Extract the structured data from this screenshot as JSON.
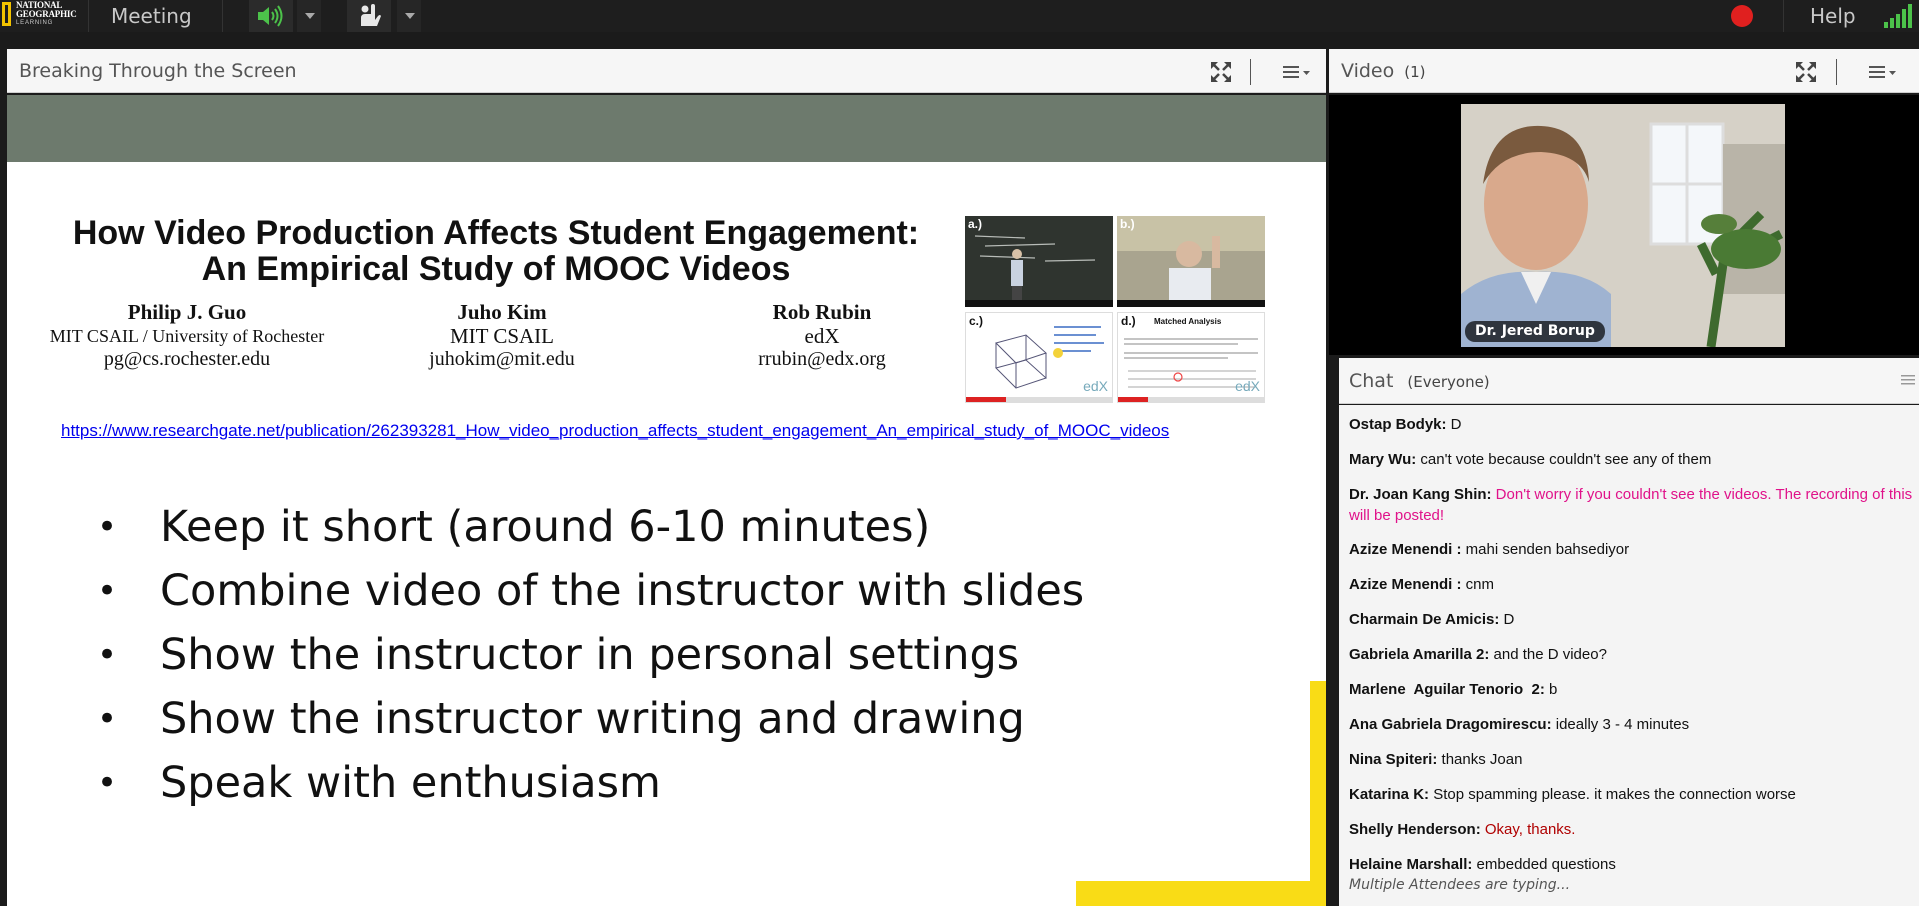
{
  "menubar": {
    "logo_line1": "NATIONAL",
    "logo_line2": "GEOGRAPHIC",
    "logo_line3": "LEARNING",
    "meeting_label": "Meeting",
    "help_label": "Help"
  },
  "share_pod": {
    "title": "Breaking Through the Screen"
  },
  "slide": {
    "paper_title_line1": "How Video Production Affects Student Engagement:",
    "paper_title_line2": "An Empirical Study of MOOC Videos",
    "authors": [
      {
        "name": "Philip J. Guo",
        "affiliation": "MIT CSAIL / University of Rochester",
        "email": "pg@cs.rochester.edu"
      },
      {
        "name": "Juho Kim",
        "affiliation": "MIT CSAIL",
        "email": "juhokim@mit.edu"
      },
      {
        "name": "Rob Rubin",
        "affiliation": "edX",
        "email": "rrubin@edx.org"
      }
    ],
    "thumb_labels": [
      "a.)",
      "b.)",
      "c.)",
      "d.)"
    ],
    "thumb_d_caption": "Matched Analysis",
    "thumb_brand": "edX",
    "link": "https://www.researchgate.net/publication/262393281_How_video_production_affects_student_engagement_An_empirical_study_of_MOOC_videos",
    "bullets": [
      "Keep it short (around 6-10 minutes)",
      "Combine video of the instructor with slides",
      "Show the instructor in personal settings",
      "Show the instructor writing and drawing",
      "Speak with enthusiasm"
    ]
  },
  "video_pod": {
    "title": "Video",
    "count": "(1)",
    "presenter_name": "Dr. Jered Borup"
  },
  "chat_pod": {
    "title": "Chat",
    "audience": "(Everyone)",
    "messages": [
      {
        "sender": "Ostap Bodyk:",
        "text": " D",
        "color": "#111111"
      },
      {
        "sender": "Mary Wu:",
        "text": " can't vote because couldn't see any of them",
        "color": "#111111"
      },
      {
        "sender": "Dr. Joan Kang Shin:",
        "text": " Don't worry if you couldn't see the videos. The recording of this will be posted!",
        "color": "#e0128a"
      },
      {
        "sender": "Azize Menendi :",
        "text": " mahi senden bahsediyor",
        "color": "#111111"
      },
      {
        "sender": "Azize Menendi :",
        "text": " cnm",
        "color": "#111111"
      },
      {
        "sender": "Charmain De Amicis:",
        "text": " D",
        "color": "#111111"
      },
      {
        "sender": "Gabriela Amarilla 2:",
        "text": " and the D video?",
        "color": "#111111"
      },
      {
        "sender": "Marlene  Aguilar Tenorio  2:",
        "text": " b",
        "color": "#111111"
      },
      {
        "sender": "Ana Gabriela Dragomirescu:",
        "text": " ideally 3 - 4 minutes",
        "color": "#111111"
      },
      {
        "sender": "Nina Spiteri:",
        "text": " thanks Joan",
        "color": "#111111"
      },
      {
        "sender": "Katarina K:",
        "text": " Stop spamming please. it makes the connection worse",
        "color": "#111111"
      },
      {
        "sender": "Shelly Henderson:",
        "text": " Okay, thanks.",
        "color": "#b00000"
      },
      {
        "sender": "Helaine Marshall:",
        "text": " embedded questions",
        "color": "#111111"
      }
    ],
    "typing_indicator": "Multiple Attendees are typing..."
  },
  "colors": {
    "accent_yellow": "#f9dc16",
    "record_red": "#e0201f",
    "signal_green": "#4cc24a",
    "link_blue": "#0000ee"
  }
}
